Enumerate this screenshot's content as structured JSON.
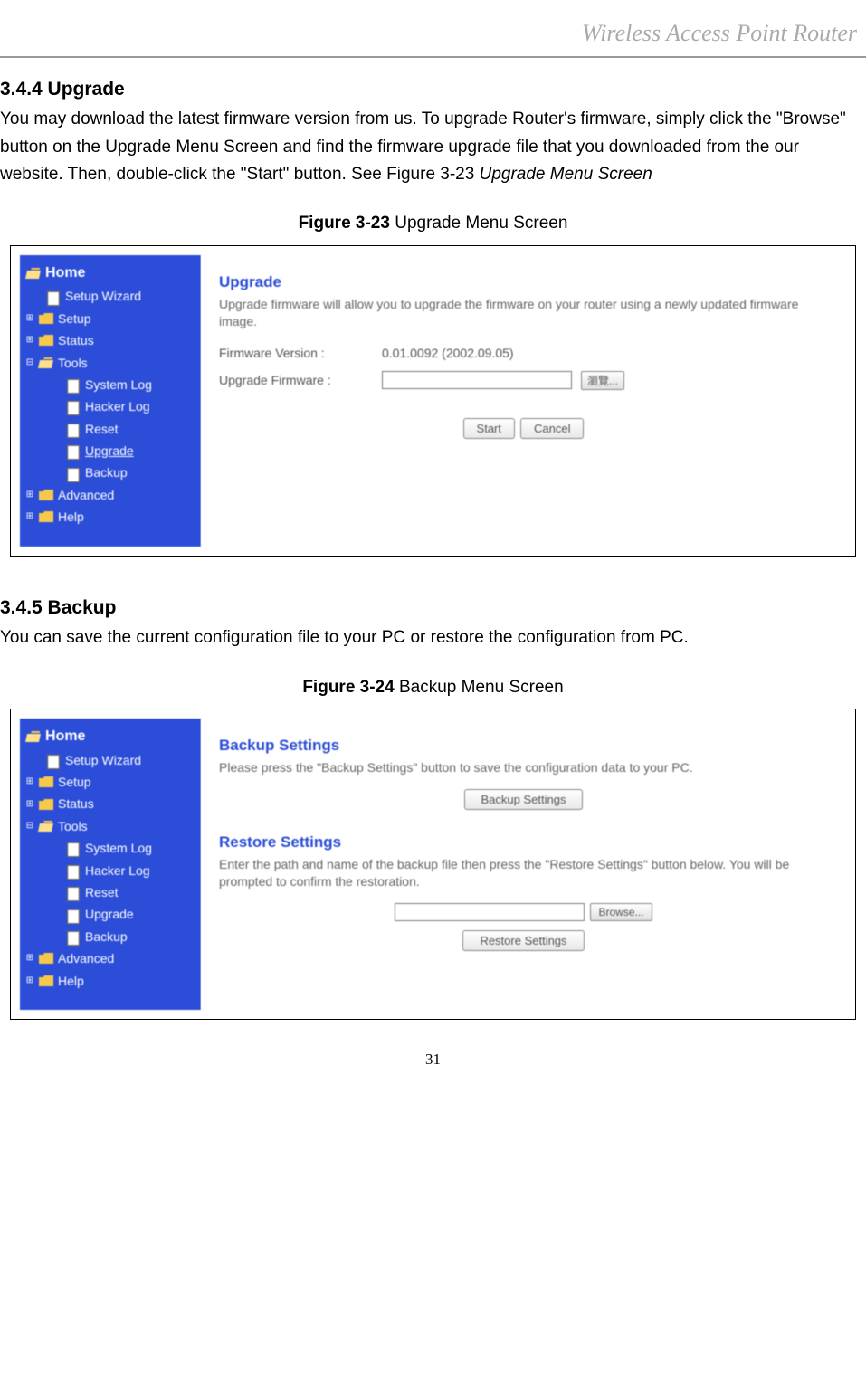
{
  "header_title": "Wireless Access Point Router",
  "section_upgrade": {
    "heading": "3.4.4 Upgrade",
    "body": "You may download the latest firmware version from us. To upgrade Router's firmware, simply click the \"Browse\" button on the Upgrade Menu Screen and find the firmware upgrade file that you downloaded from the our website. Then, double-click the \"Start\" button. See Figure 3-23 ",
    "body_italic": "Upgrade Menu Screen",
    "caption_bold": "Figure 3-23",
    "caption_rest": " Upgrade Menu Screen"
  },
  "section_backup": {
    "heading": "3.4.5 Backup",
    "body": "You can save the current configuration file to your PC or restore the configuration from PC.",
    "caption_bold": "Figure 3-24",
    "caption_rest": " Backup Menu Screen"
  },
  "sidebar": {
    "home": "Home",
    "setup_wizard": "Setup Wizard",
    "setup": "Setup",
    "status": "Status",
    "tools": "Tools",
    "system_log": "System Log",
    "hacker_log": "Hacker Log",
    "reset": "Reset",
    "upgrade": "Upgrade",
    "backup": "Backup",
    "advanced": "Advanced",
    "help": "Help"
  },
  "upgrade_panel": {
    "title": "Upgrade",
    "desc": "Upgrade firmware will allow you to upgrade the firmware on your router using a newly updated firmware image.",
    "fw_version_label": "Firmware Version :",
    "fw_version_value": "0.01.0092 (2002.09.05)",
    "upgrade_fw_label": "Upgrade Firmware :",
    "browse_label": "瀏覽...",
    "start_label": "Start",
    "cancel_label": "Cancel"
  },
  "backup_panel": {
    "backup_title": "Backup Settings",
    "backup_desc": "Please press the \"Backup Settings\" button to save the configuration data to your PC.",
    "backup_button": "Backup Settings",
    "restore_title": "Restore Settings",
    "restore_desc": "Enter the path and name of the backup file then press the \"Restore Settings\" button below. You will be prompted to confirm the restoration.",
    "browse_label": "Browse...",
    "restore_button": "Restore Settings"
  },
  "page_number": "31"
}
